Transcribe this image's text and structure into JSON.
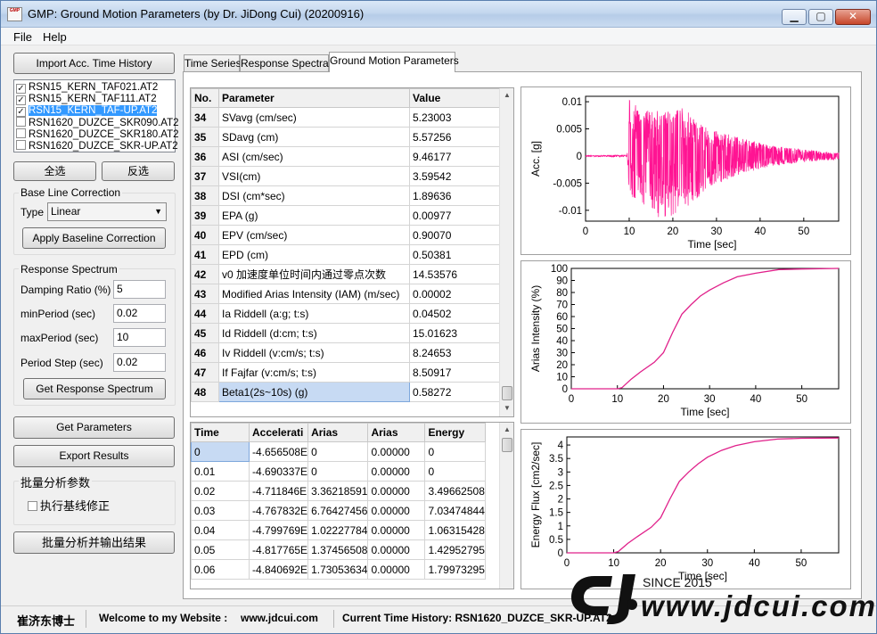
{
  "window": {
    "title": "GMP: Ground Motion Parameters (by Dr. JiDong Cui) (20200916)",
    "icon_text": "GMP"
  },
  "menu": [
    "File",
    "Help"
  ],
  "left": {
    "import_button": "Import Acc. Time History",
    "files": [
      {
        "name": "RSN15_KERN_TAF021.AT2",
        "checked": true,
        "selected": false
      },
      {
        "name": "RSN15_KERN_TAF111.AT2",
        "checked": true,
        "selected": false
      },
      {
        "name": "RSN15_KERN_TAF-UP.AT2",
        "checked": true,
        "selected": true
      },
      {
        "name": "RSN1620_DUZCE_SKR090.AT2",
        "checked": false,
        "selected": false
      },
      {
        "name": "RSN1620_DUZCE_SKR180.AT2",
        "checked": false,
        "selected": false
      },
      {
        "name": "RSN1620_DUZCE_SKR-UP.AT2",
        "checked": false,
        "selected": false
      }
    ],
    "select_all": "全选",
    "invert_select": "反选",
    "baseline": {
      "title": "Base Line Correction",
      "type_label": "Type",
      "type_value": "Linear",
      "apply_button": "Apply Baseline Correction"
    },
    "response": {
      "title": "Response Spectrum",
      "damping_label": "Damping Ratio (%)",
      "damping_value": "5",
      "minperiod_label": "minPeriod (sec)",
      "minperiod_value": "0.02",
      "maxperiod_label": "maxPeriod (sec)",
      "maxperiod_value": "10",
      "step_label": "Period Step (sec)",
      "step_value": "0.02",
      "get_button": "Get Response Spectrum"
    },
    "get_parameters": "Get Parameters",
    "export_results": "Export Results",
    "batch": {
      "title": "批量分析参数",
      "checkbox_label": "执行基线修正",
      "checked": false
    },
    "batch_button": "批量分析并输出结果"
  },
  "tabs": [
    "Time Series",
    "Response Spectra",
    "Ground Motion Parameters"
  ],
  "active_tab": 2,
  "params_table": {
    "headers": [
      "No.",
      "Parameter",
      "Value"
    ],
    "rows": [
      [
        "34",
        "SVavg (cm/sec)",
        "5.23003"
      ],
      [
        "35",
        "SDavg (cm)",
        "5.57256"
      ],
      [
        "36",
        "ASI (cm/sec)",
        "9.46177"
      ],
      [
        "37",
        "VSI(cm)",
        "3.59542"
      ],
      [
        "38",
        "DSI (cm*sec)",
        "1.89636"
      ],
      [
        "39",
        "EPA (g)",
        "0.00977"
      ],
      [
        "40",
        "EPV (cm/sec)",
        "0.90070"
      ],
      [
        "41",
        "EPD (cm)",
        "0.50381"
      ],
      [
        "42",
        "v0 加速度单位时间内通过零点次数",
        "14.53576"
      ],
      [
        "43",
        "Modified Arias Intensity (IAM) (m/sec)",
        "0.00002"
      ],
      [
        "44",
        "Ia Riddell (a:g; t:s)",
        "0.04502"
      ],
      [
        "45",
        "Id Riddell (d:cm; t:s)",
        "15.01623"
      ],
      [
        "46",
        "Iv Riddell (v:cm/s; t:s)",
        "8.24653"
      ],
      [
        "47",
        "If Fajfar (v:cm/s; t:s)",
        "8.50917"
      ],
      [
        "48",
        "Beta1(2s~10s) (g)",
        "0.58272"
      ]
    ]
  },
  "series_table": {
    "headers": [
      "Time",
      "Accelerati",
      "Arias",
      "Arias",
      "Energy"
    ],
    "rows": [
      [
        "0",
        "-4.656508E",
        "0",
        "0.00000",
        "0"
      ],
      [
        "0.01",
        "-4.690337E",
        "0",
        "0.00000",
        "0"
      ],
      [
        "0.02",
        "-4.711846E",
        "3.36218591",
        "0.00000",
        "3.49662508"
      ],
      [
        "0.03",
        "-4.767832E",
        "6.76427456",
        "0.00000",
        "7.03474844"
      ],
      [
        "0.04",
        "-4.799769E",
        "1.02227784",
        "0.00000",
        "1.06315428"
      ],
      [
        "0.05",
        "-4.817765E",
        "1.37456508",
        "0.00000",
        "1.42952795"
      ],
      [
        "0.06",
        "-4.840692E",
        "1.73053634",
        "0.00000",
        "1.79973295"
      ]
    ]
  },
  "chart_data": [
    {
      "type": "line",
      "xlabel": "Time [sec]",
      "ylabel": "Acc. [g]",
      "xlim": [
        0,
        58
      ],
      "ylim": [
        -0.012,
        0.011
      ],
      "x_ticks": [
        "0",
        "10",
        "20",
        "30",
        "40",
        "50"
      ],
      "y_ticks": [
        "0.01",
        "0.005",
        "0",
        "-0.005",
        "-0.01"
      ],
      "y_tick_values": [
        0.01,
        0.005,
        0,
        -0.005,
        -0.01
      ],
      "color": "#ff1493",
      "series": [
        {
          "envelope": [
            [
              0,
              0.0001
            ],
            [
              9.5,
              0.0002
            ],
            [
              10,
              0.0105
            ],
            [
              13,
              0.0085
            ],
            [
              18,
              0.0082
            ],
            [
              21,
              0.0095
            ],
            [
              24,
              0.008
            ],
            [
              28,
              0.005
            ],
            [
              35,
              0.0035
            ],
            [
              42,
              0.002
            ],
            [
              50,
              0.0012
            ],
            [
              58,
              0.0006
            ]
          ],
          "envelope_neg": [
            [
              0,
              -0.0001
            ],
            [
              9.5,
              -0.0002
            ],
            [
              10,
              -0.0075
            ],
            [
              13,
              -0.0095
            ],
            [
              17,
              -0.0115
            ],
            [
              21,
              -0.011
            ],
            [
              24,
              -0.009
            ],
            [
              28,
              -0.006
            ],
            [
              35,
              -0.0035
            ],
            [
              42,
              -0.002
            ],
            [
              50,
              -0.0012
            ],
            [
              58,
              -0.0006
            ]
          ]
        }
      ]
    },
    {
      "type": "line",
      "xlabel": "Time [sec]",
      "ylabel": "Arias Intensity (%)",
      "xlim": [
        0,
        58
      ],
      "ylim": [
        0,
        100
      ],
      "x_ticks": [
        "0",
        "10",
        "20",
        "30",
        "40",
        "50"
      ],
      "y_ticks": [
        "100",
        "90",
        "80",
        "70",
        "60",
        "50",
        "40",
        "30",
        "20",
        "10",
        "0"
      ],
      "color": "#e0208a",
      "series": [
        {
          "x": [
            0,
            10,
            11,
            13,
            15,
            18,
            20,
            22,
            24,
            26,
            28,
            30,
            33,
            36,
            40,
            45,
            50,
            58
          ],
          "y": [
            0,
            0,
            1,
            8,
            14,
            22,
            30,
            47,
            62,
            70,
            77,
            82,
            88,
            93,
            96,
            99,
            99.5,
            100
          ]
        }
      ]
    },
    {
      "type": "line",
      "xlabel": "Time [sec]",
      "ylabel": "Energy Flux [cm2/sec]",
      "xlim": [
        0,
        58
      ],
      "ylim": [
        0,
        4.3
      ],
      "x_ticks": [
        "0",
        "10",
        "20",
        "30",
        "40",
        "50"
      ],
      "y_ticks": [
        "4",
        "3.5",
        "3",
        "2.5",
        "2",
        "1.5",
        "1",
        "0.5",
        "0"
      ],
      "y_tick_values": [
        4,
        3.5,
        3,
        2.5,
        2,
        1.5,
        1,
        0.5,
        0
      ],
      "color": "#e0208a",
      "series": [
        {
          "x": [
            0,
            10,
            11,
            13,
            15,
            18,
            20,
            22,
            24,
            26,
            28,
            30,
            33,
            36,
            40,
            45,
            50,
            58
          ],
          "y": [
            0,
            0,
            0.05,
            0.35,
            0.6,
            0.95,
            1.3,
            2.0,
            2.65,
            3.0,
            3.3,
            3.55,
            3.8,
            3.98,
            4.12,
            4.22,
            4.25,
            4.26
          ]
        }
      ]
    }
  ],
  "status": {
    "author": "崔济东博士",
    "welcome": "Welcome to my Website :",
    "site": "www.jdcui.com",
    "current": "Current Time History: RSN1620_DUZCE_SKR-UP.AT2"
  },
  "watermark": {
    "since": "SINCE 2015",
    "url": "www.jdcui.com"
  }
}
